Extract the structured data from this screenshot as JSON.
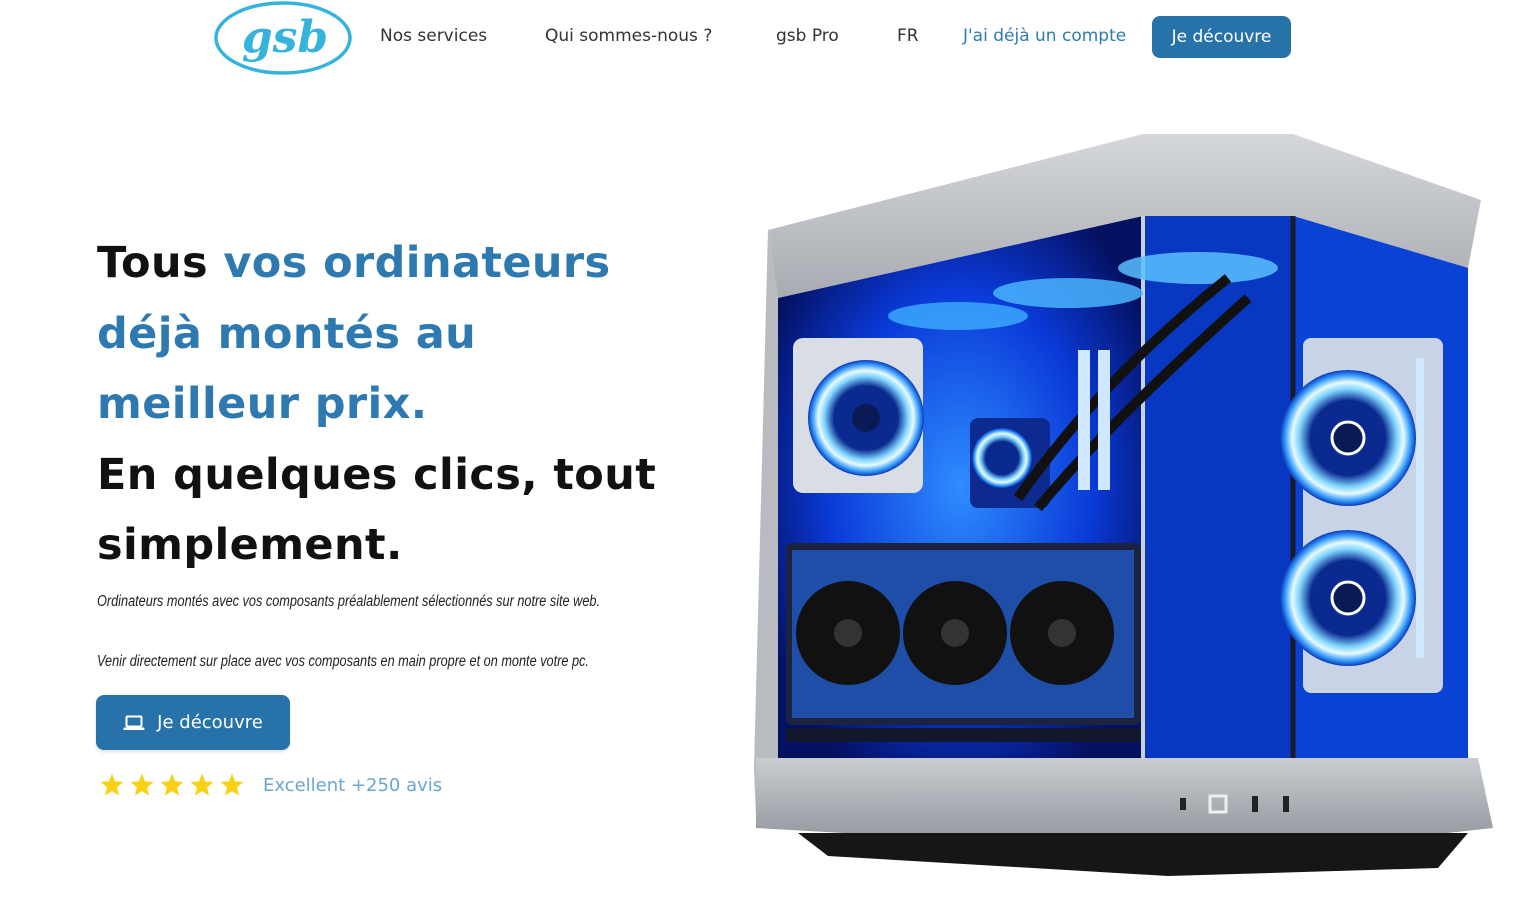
{
  "nav": {
    "logo_text": "gsb",
    "links": [
      "Nos services",
      "Qui sommes-nous ?",
      "gsb Pro",
      "FR"
    ],
    "account_link": "J'ai déjà un compte",
    "cta_label": "Je découvre"
  },
  "hero": {
    "title_plain_1": "Tous ",
    "title_accent": [
      "vos ordinateurs",
      "déjà montés au",
      "meilleur prix."
    ],
    "title_plain_2": [
      "En quelques clics, tout",
      "simplement."
    ],
    "subtitle_1": "Ordinateurs montés avec vos composants préalablement sélectionnés sur notre site web.",
    "subtitle_2": "Venir directement sur place avec vos composants en main propre et on monte votre pc.",
    "cta_label": "Je découvre",
    "cta_icon": "laptop-icon",
    "rating": 5,
    "rating_max": 5,
    "rating_text": "Excellent +250 avis"
  },
  "colors": {
    "brand": "#2872aa",
    "accent_text": "#2e7ab0",
    "star": "#f7d116",
    "rating_text": "#6aa6d1"
  }
}
